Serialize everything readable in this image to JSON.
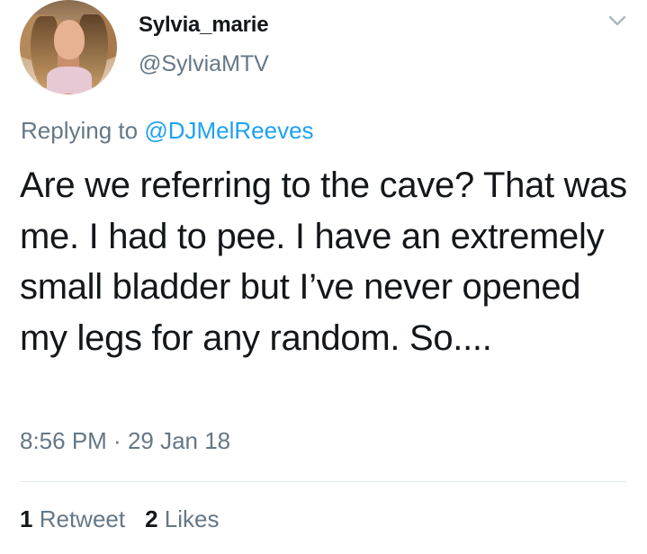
{
  "tweet": {
    "author_name": "Sylvia_marie",
    "author_handle": "@SylviaMTV",
    "replying_prefix": "Replying to ",
    "replying_handle": "@DJMelReeves",
    "text": "Are we referring to the cave? That was me. I had to pee. I have an extremely small bladder but I’ve never opened my legs for any random. So....",
    "time": "8:56 PM",
    "separator": " · ",
    "date": "29 Jan 18",
    "retweets_count": "1",
    "retweets_label": "Retweet",
    "likes_count": "2",
    "likes_label": "Likes"
  },
  "icons": {
    "menu": "chevron-down-icon"
  },
  "colors": {
    "text": "#14171a",
    "secondary": "#657786",
    "link": "#1da1f2",
    "divider": "#e1e8ed"
  }
}
